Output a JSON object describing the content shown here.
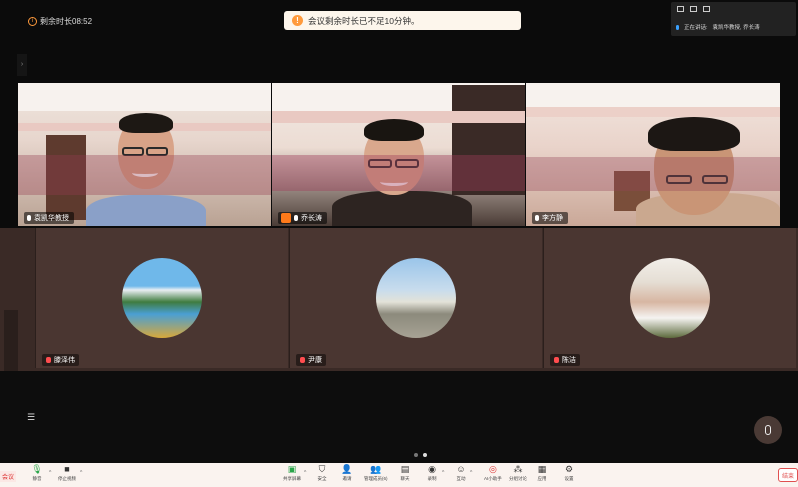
{
  "top": {
    "remaining_time": "剩余时长08:52",
    "toast": "会议剩余时长已不足10分钟。"
  },
  "speaking": {
    "label": "正在讲话:",
    "names": "袁凯华教授, 乔长涛"
  },
  "participants_video": [
    {
      "name": "袁凯华教授"
    },
    {
      "name": "乔长涛"
    },
    {
      "name": "李方静"
    }
  ],
  "participants_avatar": [
    {
      "name": "滕泽伟"
    },
    {
      "name": "尹康"
    },
    {
      "name": "陈洁"
    }
  ],
  "toolbar": {
    "mute": "静音",
    "stop_video": "停止视频",
    "share_screen": "共享屏幕",
    "security": "安全",
    "invite": "邀请",
    "manage_members": "管理成员(6)",
    "chat": "聊天",
    "record": "录制",
    "reactions": "互动",
    "ai_assistant": "AI小助手",
    "breakout": "分组讨论",
    "apps": "应用",
    "settings": "设置",
    "end": "结束"
  },
  "meeting_tag": "会议",
  "colors": {
    "accent_orange": "#ff9a3c",
    "end_red": "#e05050",
    "mic_muted": "#ff4d4f"
  }
}
